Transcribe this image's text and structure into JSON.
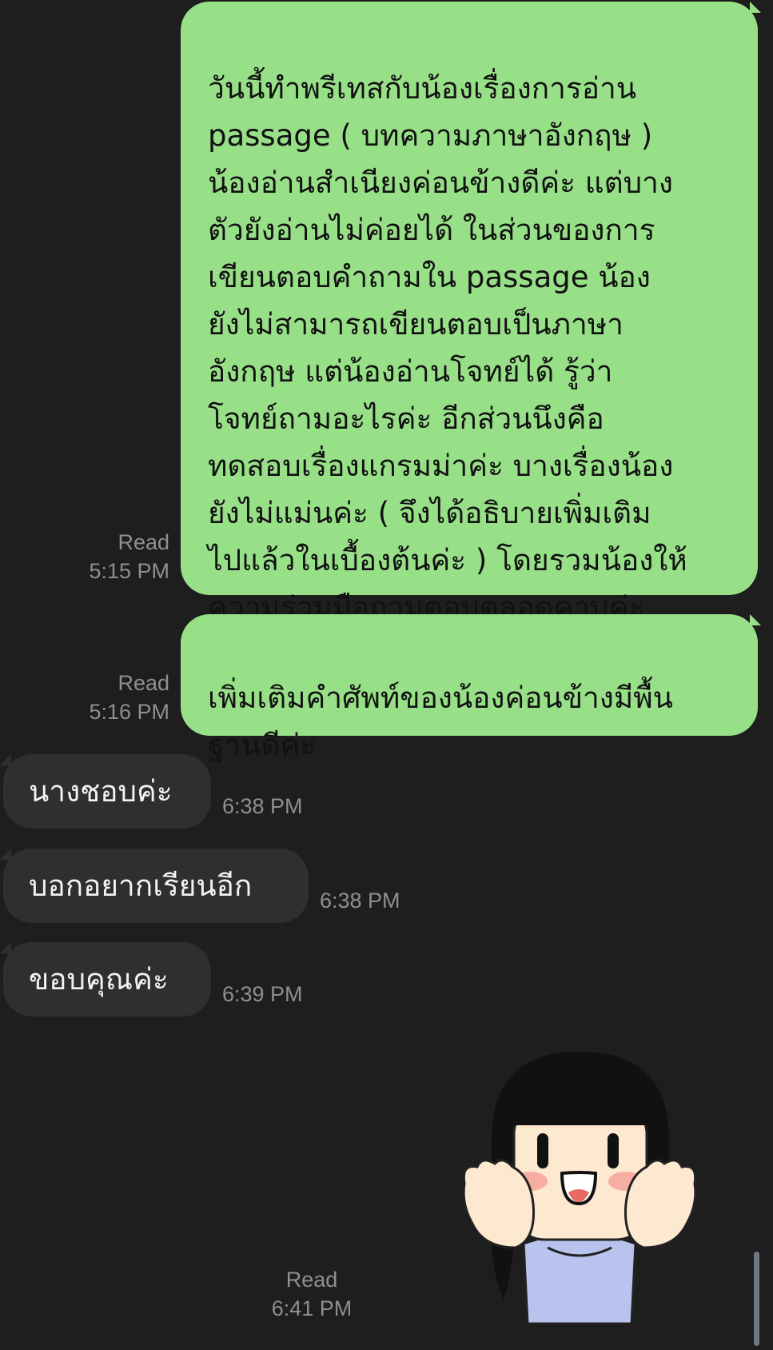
{
  "messages": [
    {
      "id": "m1",
      "direction": "outgoing",
      "text": "วันนี้ทำพรีเทสกับน้องเรื่องการอ่าน\npassage ( บทความภาษาอังกฤษ )\nน้องอ่านสำเนียงค่อนข้างดีค่ะ แต่บาง\nตัวยังอ่านไม่ค่อยได้ ในส่วนของการ\nเขียนตอบคำถามใน passage น้อง\nยังไม่สามารถเขียนตอบเป็นภาษา\nอังกฤษ  แต่น้องอ่านโจทย์ได้ รู้ว่า\nโจทย์ถามอะไรค่ะ  อีกส่วนนึงคือ\nทดสอบเรื่องแกรมม่าค่ะ  บางเรื่องน้อง\nยังไม่แม่นค่ะ ( จึงได้อธิบายเพิ่มเติม\nไปแล้วในเบื้องต้นค่ะ ) โดยรวมน้องให้\nความร่วมมือถามตอบตลอดคาบค่ะ",
      "status": "Read",
      "time": "5:15 PM"
    },
    {
      "id": "m2",
      "direction": "outgoing",
      "text": "เพิ่มเติมคำศัพท์ของน้องค่อนข้างมีพื้น\nฐานดีค่ะ",
      "status": "Read",
      "time": "5:16 PM"
    },
    {
      "id": "m3",
      "direction": "incoming",
      "text": "นางชอบค่ะ",
      "time": "6:38 PM"
    },
    {
      "id": "m4",
      "direction": "incoming",
      "text": "บอกอยากเรียนอีก",
      "time": "6:38 PM"
    },
    {
      "id": "m5",
      "direction": "incoming",
      "text": "ขอบคุณค่ะ",
      "time": "6:39 PM"
    },
    {
      "id": "m6",
      "direction": "outgoing",
      "type": "sticker",
      "sticker": "happy-girl-sticker",
      "status": "Read",
      "time": "6:41 PM"
    }
  ],
  "colors": {
    "background": "#1e1e1e",
    "outgoing_bubble": "#98e088",
    "incoming_bubble": "#2f2f2f",
    "meta_text": "#8f8f8f"
  }
}
